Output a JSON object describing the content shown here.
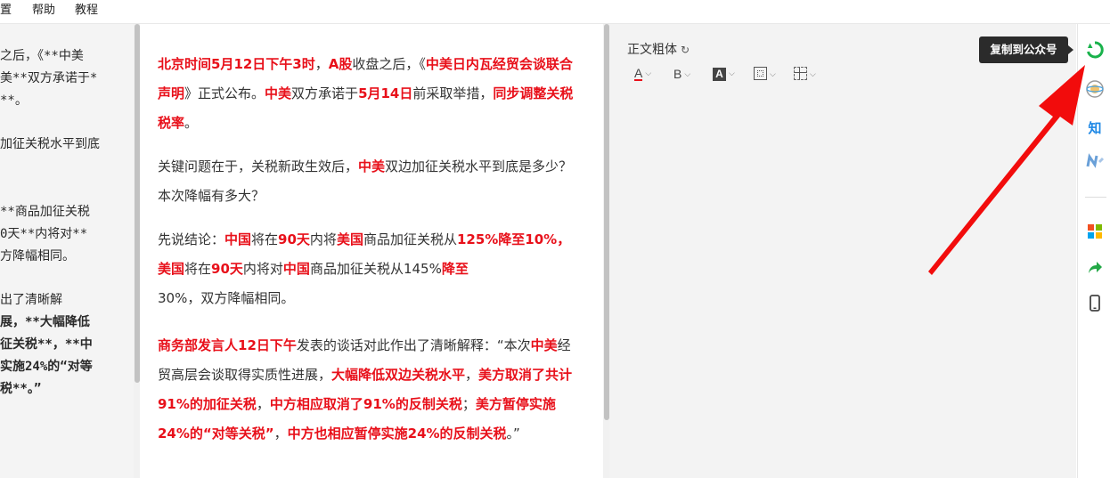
{
  "menu": {
    "item_partial": "置",
    "help": "帮助",
    "tutorial": "教程"
  },
  "editor": {
    "lines": [
      "之后，《**中美",
      "美**双方承诺于*",
      "**。",
      "加征关税水平到底",
      "**商品加征关税",
      "0天**内将对**",
      "方降幅相同。",
      "出了清晰解",
      "展，**大幅降低",
      "征关税**，**中",
      "实施24%的“对等",
      "税**。”"
    ]
  },
  "preview": {
    "p1": {
      "s1": "北京时间5月12日下午3时",
      "s2": "，",
      "s3": "A股",
      "s4": "收盘之后，《",
      "s5": "中美日内瓦经贸会谈联合声明",
      "s6": "》正式公布。",
      "s7": "中美",
      "s8": "双方承诺于",
      "s9": "5月14日",
      "s10": "前采取举措，",
      "s11": "同步调整关税税率",
      "s12": "。"
    },
    "p2": {
      "s1": "关键问题在于，关税新政生效后，",
      "s2": "中美",
      "s3": "双边加征关税水平到底是多少？本次降幅有多大？"
    },
    "p3": {
      "s1": "先说结论：",
      "s2": "中国",
      "s3": "将在",
      "s4": "90天",
      "s5": "内将",
      "s6": "美国",
      "s7": "商品加征关税从",
      "s8": "125%降至10%，",
      "s9": "美国",
      "s10": "将在",
      "s11": "90天",
      "s12": "内将对",
      "s13": "中国",
      "s14": "商品加征关税从145%",
      "s15": "降至",
      "s16": "30%，双方降幅相同。"
    },
    "p4": {
      "s1": "商务部发言人12日下午",
      "s2": "发表的谈话对此作出了清晰解释：“本次",
      "s3": "中美",
      "s4": "经贸高层会谈取得实质性进展，",
      "s5": "大幅降低双边关税水平",
      "s6": "，",
      "s7": "美方取消了共计91%的加征关税",
      "s8": "，",
      "s9": "中方相应取消了91%的反制关税",
      "s10": "；",
      "s11": "美方暂停实施24%的“对等关税”",
      "s12": "，",
      "s13": "中方也相应暂停实施24%的反制关税",
      "s14": "。”"
    }
  },
  "style_panel": {
    "title": "正文粗体",
    "refresh_glyph": "↻",
    "tools": {
      "font_color": "A",
      "bold": "B",
      "bg_color": "A",
      "caret": "⌵"
    }
  },
  "tooltip": {
    "text": "复制到公众号"
  },
  "sidebar": {
    "zhihu": "知"
  },
  "colors": {
    "accent_red": "#e8101a",
    "wechat_green": "#19b24b",
    "share_green": "#22a846"
  }
}
